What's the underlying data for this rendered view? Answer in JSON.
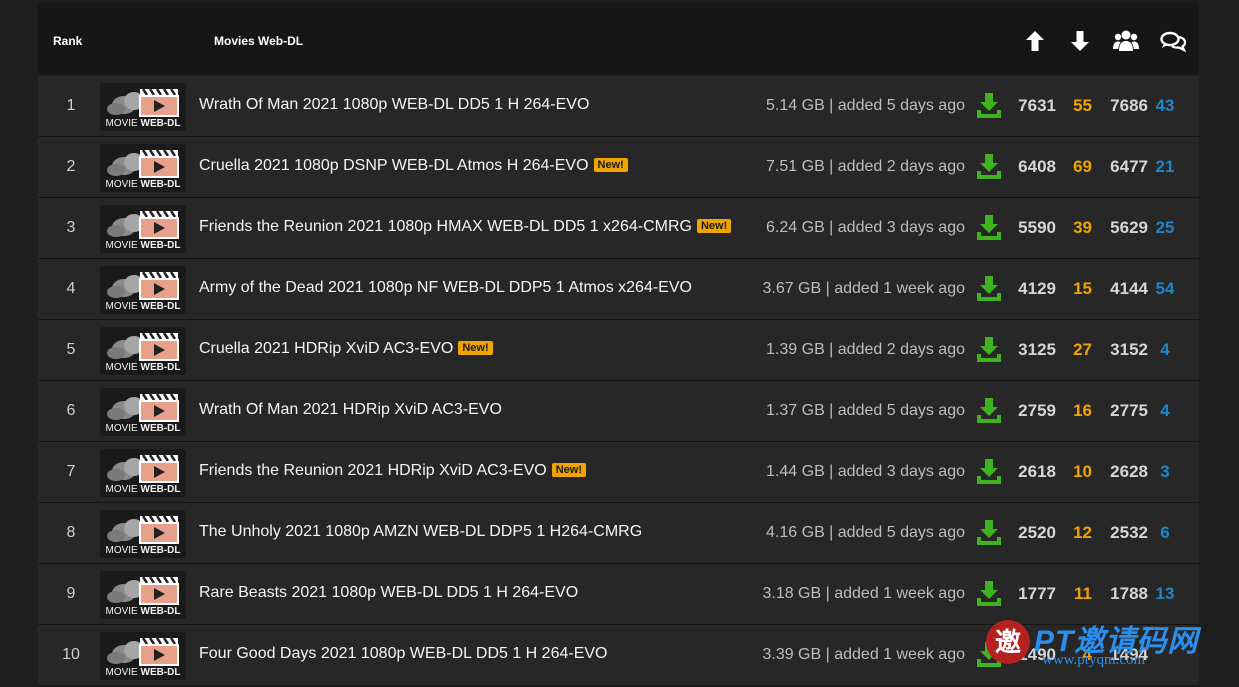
{
  "header": {
    "rank_label": "Rank",
    "category_title": "Movies Web-DL",
    "icons": [
      "arrow-up-icon",
      "arrow-down-icon",
      "users-icon",
      "comments-icon"
    ]
  },
  "thumb": {
    "label_prefix": "MOVIE ",
    "label_bold": "WEB-DL"
  },
  "new_badge": "New!",
  "colors": {
    "leech": "#f0a400",
    "comments": "#1f86c9",
    "download": "#3fb21f"
  },
  "rows": [
    {
      "rank": "1",
      "title": "Wrath Of Man 2021 1080p WEB-DL DD5 1 H 264-EVO",
      "new": false,
      "info": "5.14 GB | added 5 days ago",
      "seeders": "7631",
      "leechers": "55",
      "total": "7686",
      "comments": "43"
    },
    {
      "rank": "2",
      "title": "Cruella 2021 1080p DSNP WEB-DL Atmos H 264-EVO",
      "new": true,
      "info": "7.51 GB | added 2 days ago",
      "seeders": "6408",
      "leechers": "69",
      "total": "6477",
      "comments": "21"
    },
    {
      "rank": "3",
      "title": "Friends the Reunion 2021 1080p HMAX WEB-DL DD5 1 x264-CMRG",
      "new": true,
      "info": "6.24 GB | added 3 days ago",
      "seeders": "5590",
      "leechers": "39",
      "total": "5629",
      "comments": "25"
    },
    {
      "rank": "4",
      "title": "Army of the Dead 2021 1080p NF WEB-DL DDP5 1 Atmos x264-EVO",
      "new": false,
      "info": "3.67 GB | added 1 week ago",
      "seeders": "4129",
      "leechers": "15",
      "total": "4144",
      "comments": "54"
    },
    {
      "rank": "5",
      "title": "Cruella 2021 HDRip XviD AC3-EVO",
      "new": true,
      "info": "1.39 GB | added 2 days ago",
      "seeders": "3125",
      "leechers": "27",
      "total": "3152",
      "comments": "4"
    },
    {
      "rank": "6",
      "title": "Wrath Of Man 2021 HDRip XviD AC3-EVO",
      "new": false,
      "info": "1.37 GB | added 5 days ago",
      "seeders": "2759",
      "leechers": "16",
      "total": "2775",
      "comments": "4"
    },
    {
      "rank": "7",
      "title": "Friends the Reunion 2021 HDRip XviD AC3-EVO",
      "new": true,
      "info": "1.44 GB | added 3 days ago",
      "seeders": "2618",
      "leechers": "10",
      "total": "2628",
      "comments": "3"
    },
    {
      "rank": "8",
      "title": "The Unholy 2021 1080p AMZN WEB-DL DDP5 1 H264-CMRG",
      "new": false,
      "info": "4.16 GB | added 5 days ago",
      "seeders": "2520",
      "leechers": "12",
      "total": "2532",
      "comments": "6"
    },
    {
      "rank": "9",
      "title": "Rare Beasts 2021 1080p WEB-DL DD5 1 H 264-EVO",
      "new": false,
      "info": "3.18 GB | added 1 week ago",
      "seeders": "1777",
      "leechers": "11",
      "total": "1788",
      "comments": "13"
    },
    {
      "rank": "10",
      "title": "Four Good Days 2021 1080p WEB-DL DD5 1 H 264-EVO",
      "new": false,
      "info": "3.39 GB | added 1 week ago",
      "seeders": "1490",
      "leechers": "4",
      "total": "1494",
      "comments": ""
    }
  ],
  "watermark": {
    "seal": "邀",
    "text": "PT邀请码网",
    "url": "www.ptyqm.com"
  }
}
